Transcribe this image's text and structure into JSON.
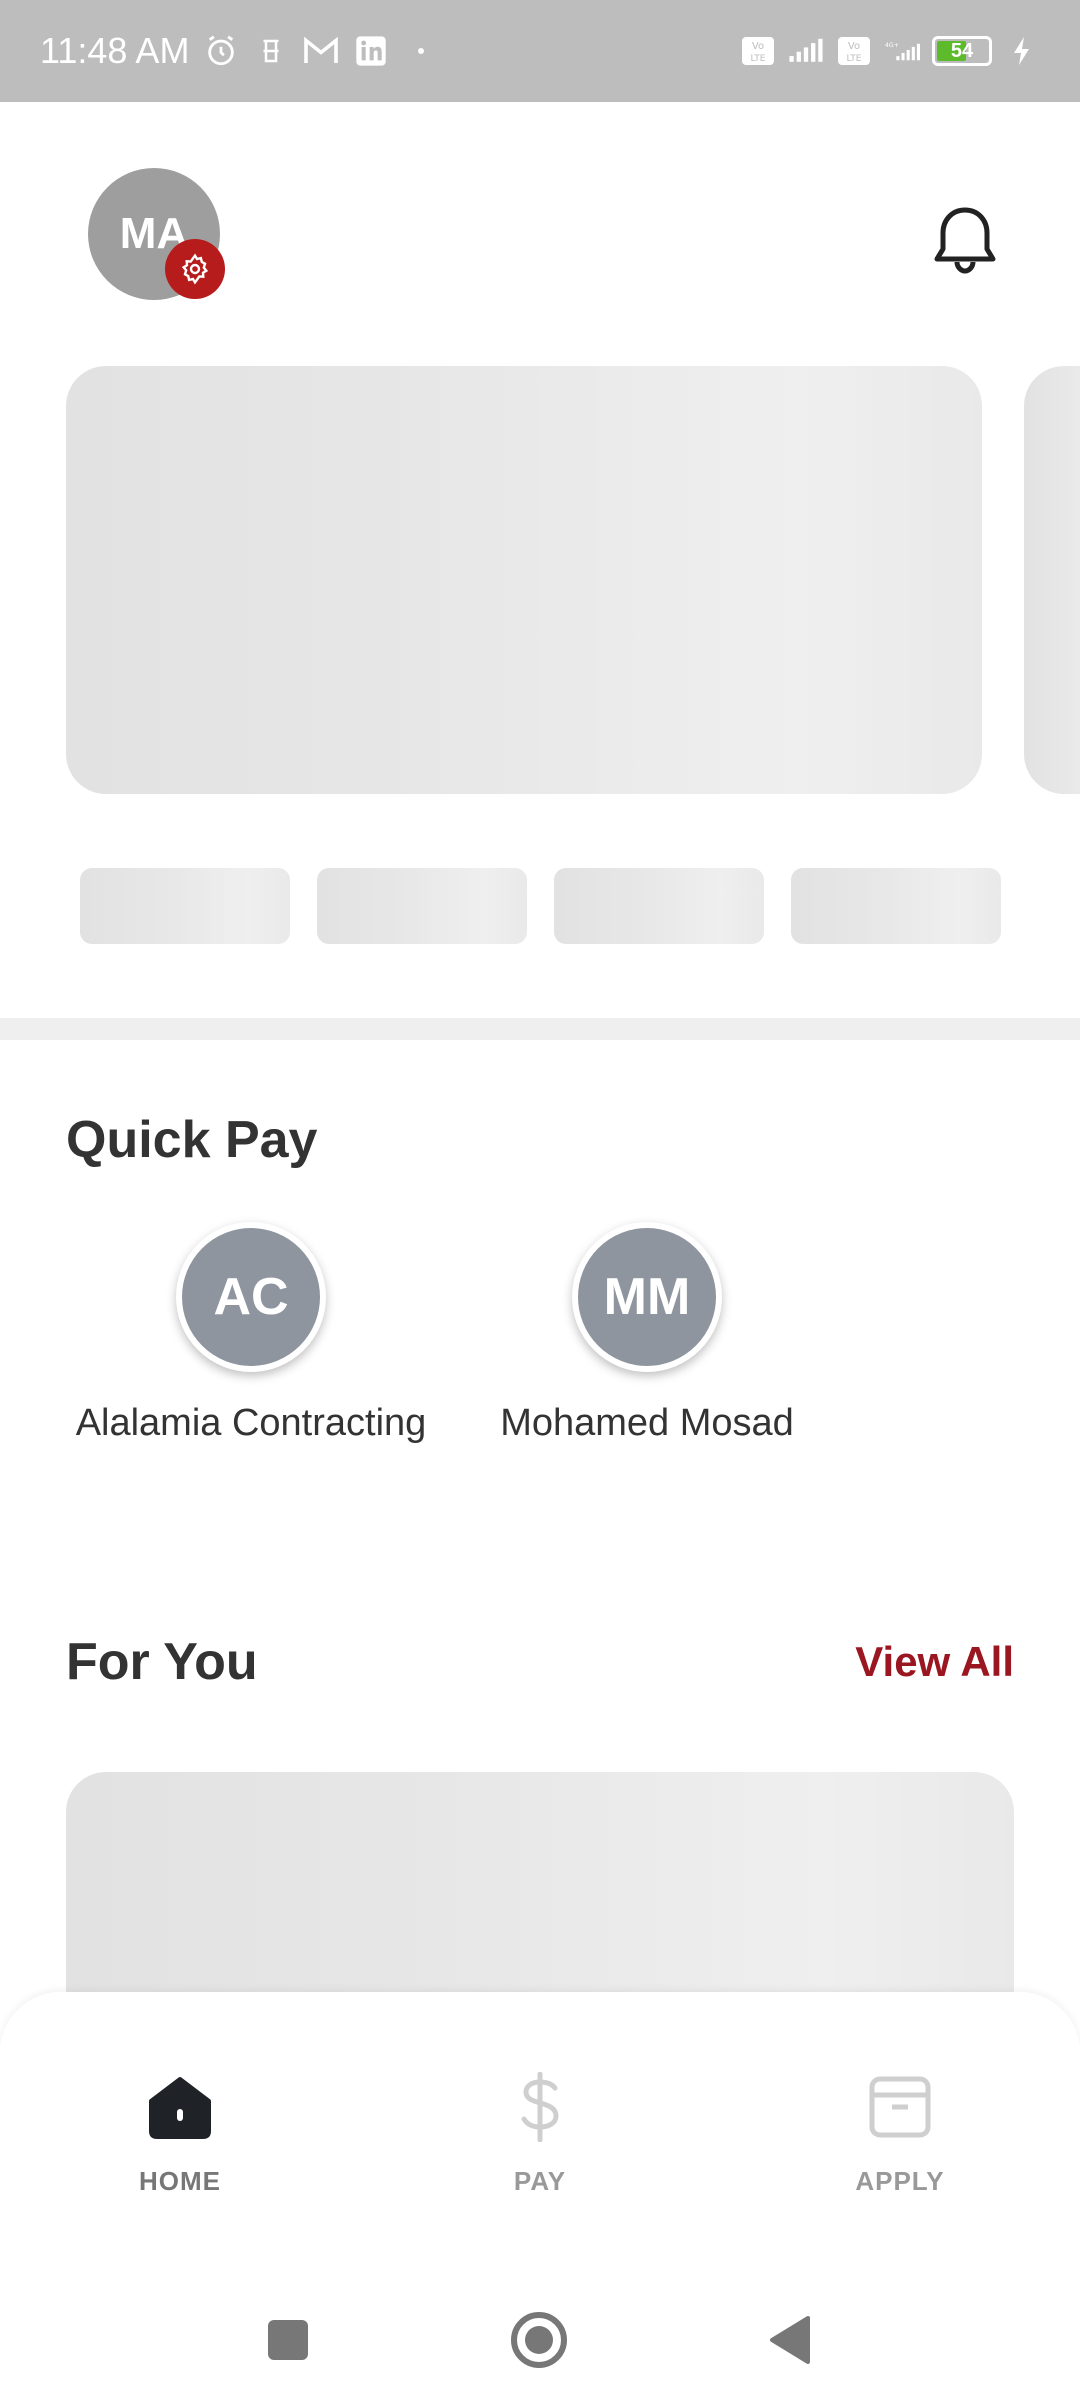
{
  "status_bar": {
    "time": "11:48 AM",
    "battery_level": "54",
    "colors": {
      "background": "#bdbdbd",
      "battery_fill": "#5dbb2b"
    }
  },
  "header": {
    "avatar_initials": "MA",
    "settings_badge_color": "#b71c1c"
  },
  "quick_pay": {
    "title": "Quick Pay",
    "contacts": [
      {
        "initials": "AC",
        "name": "Alalamia Contracting"
      },
      {
        "initials": "MM",
        "name": "Mohamed Mosad"
      }
    ]
  },
  "for_you": {
    "title": "For You",
    "view_all_label": "View All",
    "accent_color": "#9a1620"
  },
  "bottom_nav": {
    "items": [
      {
        "label": "HOME",
        "icon": "home-icon",
        "active": true
      },
      {
        "label": "PAY",
        "icon": "dollar-icon",
        "active": false
      },
      {
        "label": "APPLY",
        "icon": "archive-icon",
        "active": false
      }
    ]
  },
  "system_nav": {
    "buttons": [
      "recent-apps-icon",
      "home-circle-icon",
      "back-icon"
    ]
  }
}
